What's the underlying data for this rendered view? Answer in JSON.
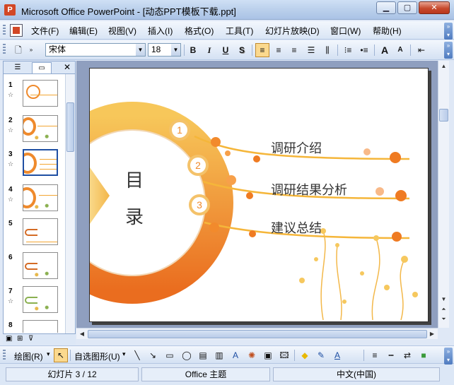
{
  "window": {
    "title": "Microsoft Office PowerPoint - [动态PPT模板下载.ppt]"
  },
  "menu": [
    "文件(F)",
    "编辑(E)",
    "视图(V)",
    "插入(I)",
    "格式(O)",
    "工具(T)",
    "幻灯片放映(D)",
    "窗口(W)",
    "帮助(H)"
  ],
  "toolbar": {
    "font_name": "宋体",
    "font_size": "18",
    "bold": "B",
    "italic": "I",
    "underline": "U",
    "shadow": "S",
    "grow_font": "A",
    "shrink_font": "A"
  },
  "thumbnails": [
    "1",
    "2",
    "3",
    "4",
    "5",
    "6",
    "7",
    "8"
  ],
  "selected_slide": 3,
  "slide": {
    "toc_char1": "目",
    "toc_char2": "录",
    "items": [
      {
        "num": "1",
        "label": "调研介绍"
      },
      {
        "num": "2",
        "label": "调研结果分析"
      },
      {
        "num": "3",
        "label": "建议总结"
      }
    ]
  },
  "drawbar": {
    "draw_label": "绘图(R)",
    "autoshapes_label": "自选图形(U)"
  },
  "status": {
    "slide_info": "幻灯片 3 / 12",
    "theme": "Office 主题",
    "language": "中文(中国)"
  },
  "colors": {
    "accent_orange": "#f08a2a",
    "slide_line": "#f5b63a",
    "selection": "#1f4fa3"
  }
}
